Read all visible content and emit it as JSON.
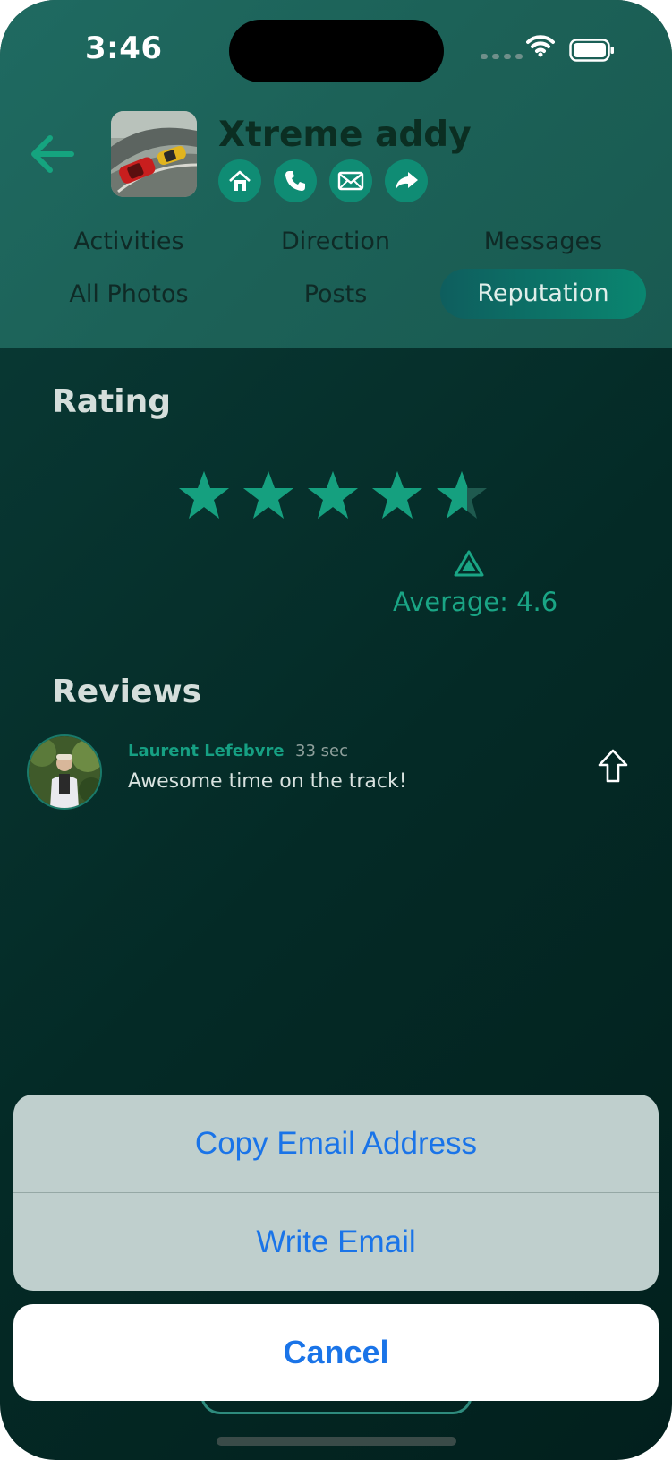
{
  "status_bar": {
    "time": "3:46"
  },
  "header": {
    "title": "Xtreme addy",
    "thumbnail_icon": "race-cars-image",
    "back_icon": "arrow-left-icon",
    "actions": [
      {
        "icon": "home-icon"
      },
      {
        "icon": "phone-icon"
      },
      {
        "icon": "mail-icon"
      },
      {
        "icon": "share-icon"
      }
    ]
  },
  "tabs": [
    {
      "label": "Activities"
    },
    {
      "label": "Direction"
    },
    {
      "label": "Messages"
    },
    {
      "label": "All Photos"
    },
    {
      "label": "Posts"
    },
    {
      "label": "Reputation",
      "active": true
    }
  ],
  "rating": {
    "section_title": "Rating",
    "star_value": 4.6,
    "star_max": 5,
    "average_label": "Average: 4.6"
  },
  "reviews": {
    "section_title": "Reviews",
    "items": [
      {
        "author": "Laurent Lefebvre",
        "time": "33 sec",
        "text": "Awesome time on the track!"
      }
    ]
  },
  "action_sheet": {
    "options": [
      "Copy Email Address",
      "Write Email"
    ],
    "cancel_label": "Cancel"
  },
  "colors": {
    "accent": "#1aa585",
    "header_bg": "#1f6a61",
    "body_bg": "#042a26",
    "ios_blue": "#1a74e8"
  }
}
